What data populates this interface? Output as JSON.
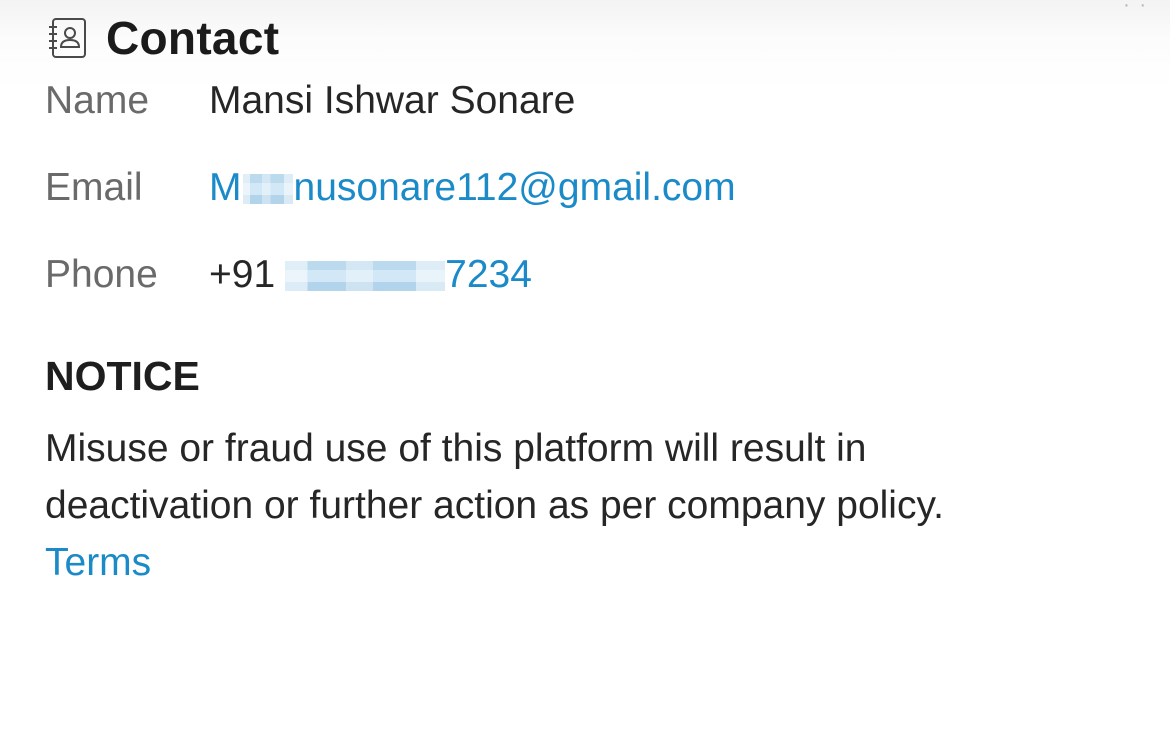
{
  "header": {
    "title": "Contact",
    "icon": "contact-book-icon"
  },
  "fields": {
    "name": {
      "label": "Name",
      "value": "Mansi Ishwar Sonare"
    },
    "email": {
      "label": "Email",
      "value_prefix": "M",
      "value_suffix": "nusonare112@gmail.com",
      "redacted": true
    },
    "phone": {
      "label": "Phone",
      "country_code": "+91",
      "value_suffix": "7234",
      "redacted": true
    }
  },
  "notice": {
    "title": "NOTICE",
    "body": "Misuse or fraud use of this platform will result in deactivation or further action as per company policy.",
    "terms_label": "Terms"
  },
  "colors": {
    "link": "#1a8ac8",
    "label": "#6a6a6a",
    "text": "#262626"
  }
}
